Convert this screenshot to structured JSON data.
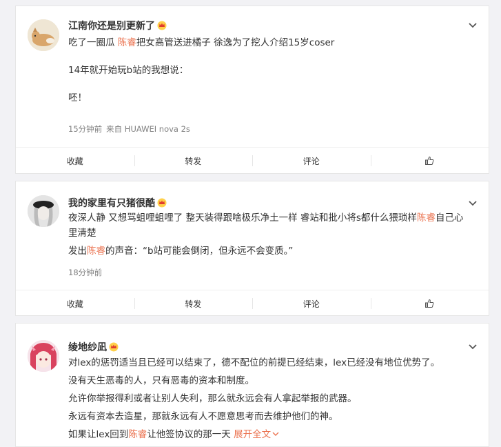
{
  "posts": [
    {
      "username": "江南你还是别更新了",
      "paragraphs": [
        {
          "before": "吃了一圈瓜 ",
          "highlight": "陈睿",
          "after": "把女高管送进橘子 徐逸为了挖人介绍15岁coser"
        },
        {
          "before": "14年就开始玩b站的我想说：",
          "highlight": "",
          "after": ""
        },
        {
          "before": "呸！",
          "highlight": "",
          "after": ""
        }
      ],
      "time": "15分钟前",
      "source": "来自 HUAWEI nova 2s",
      "actions": {
        "collect": "收藏",
        "repost": "转发",
        "comment": "评论"
      }
    },
    {
      "username": "我的家里有只猪很酷",
      "paragraphs": [
        {
          "before": "夜深人静 又想骂蛆哩蛆哩了 整天装得跟啥极乐净土一样 睿站和批小将s都什么猥琐样",
          "highlight": "陈睿",
          "after": "自己心里清楚"
        },
        {
          "before": "发出",
          "highlight": "陈睿",
          "after": "的声音：“b站可能会倒闭，但永远不会变质。”"
        }
      ],
      "time": "18分钟前",
      "source": "",
      "actions": {
        "collect": "收藏",
        "repost": "转发",
        "comment": "评论"
      }
    },
    {
      "username": "绫地纱凪",
      "paragraphs": [
        {
          "before": "对lex的惩罚适当且已经可以结束了，德不配位的前提已经结束，lex已经没有地位优势了。",
          "highlight": "",
          "after": ""
        },
        {
          "before": "没有天生恶毒的人，只有恶毒的资本和制度。",
          "highlight": "",
          "after": ""
        },
        {
          "before": "允许你举报得利或者让别人失利，那么就永远会有人拿起举报的武器。",
          "highlight": "",
          "after": ""
        },
        {
          "before": "永远有资本去造星，那就永远有人不愿意思考而去维护他们的神。",
          "highlight": "",
          "after": ""
        },
        {
          "before": "如果让lex回到",
          "highlight": "陈睿",
          "after": "让他签协议的那一天 "
        }
      ],
      "expand": "展开全文"
    }
  ],
  "icons": {
    "crown": "crown-icon",
    "chevron": "chevron-down-icon",
    "like": "thumbs-up-icon"
  },
  "colors": {
    "highlight": "#eb7350",
    "crown": "#e8a200",
    "background": "#f2f2f5"
  }
}
